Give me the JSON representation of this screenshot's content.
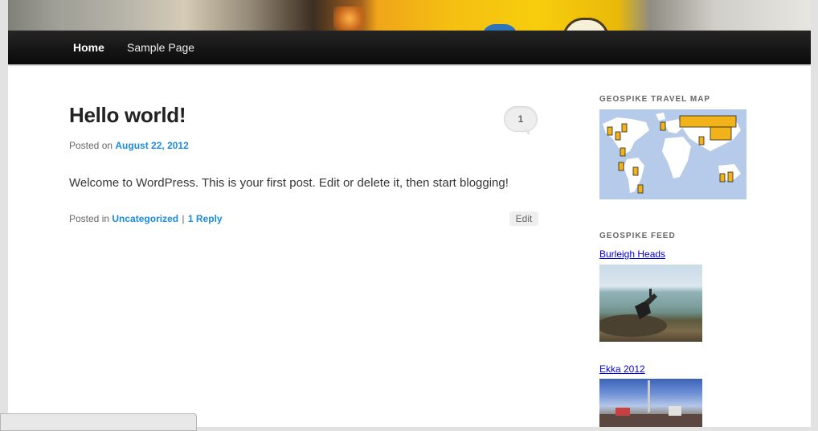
{
  "nav": {
    "items": [
      {
        "label": "Home",
        "current": true
      },
      {
        "label": "Sample Page",
        "current": false
      }
    ]
  },
  "post": {
    "title": "Hello world!",
    "comment_count": "1",
    "posted_on_label": "Posted on",
    "date": "August 22, 2012",
    "content": "Welcome to WordPress. This is your first post. Edit or delete it, then start blogging!",
    "posted_in_label": "Posted in",
    "category": "Uncategorized",
    "separator": "|",
    "reply_link": "1 Reply",
    "edit_label": "Edit"
  },
  "sidebar": {
    "travel_map": {
      "title": "GEOSPIKE TRAVEL MAP"
    },
    "feed": {
      "title": "GEOSPIKE FEED",
      "items": [
        {
          "label": "Burleigh Heads"
        },
        {
          "label": "Ekka 2012"
        }
      ]
    }
  },
  "colors": {
    "link": "#1b8be0",
    "nav_bg": "#111111",
    "map_water": "#b5cbe9",
    "map_spike": "#f2b21a"
  }
}
